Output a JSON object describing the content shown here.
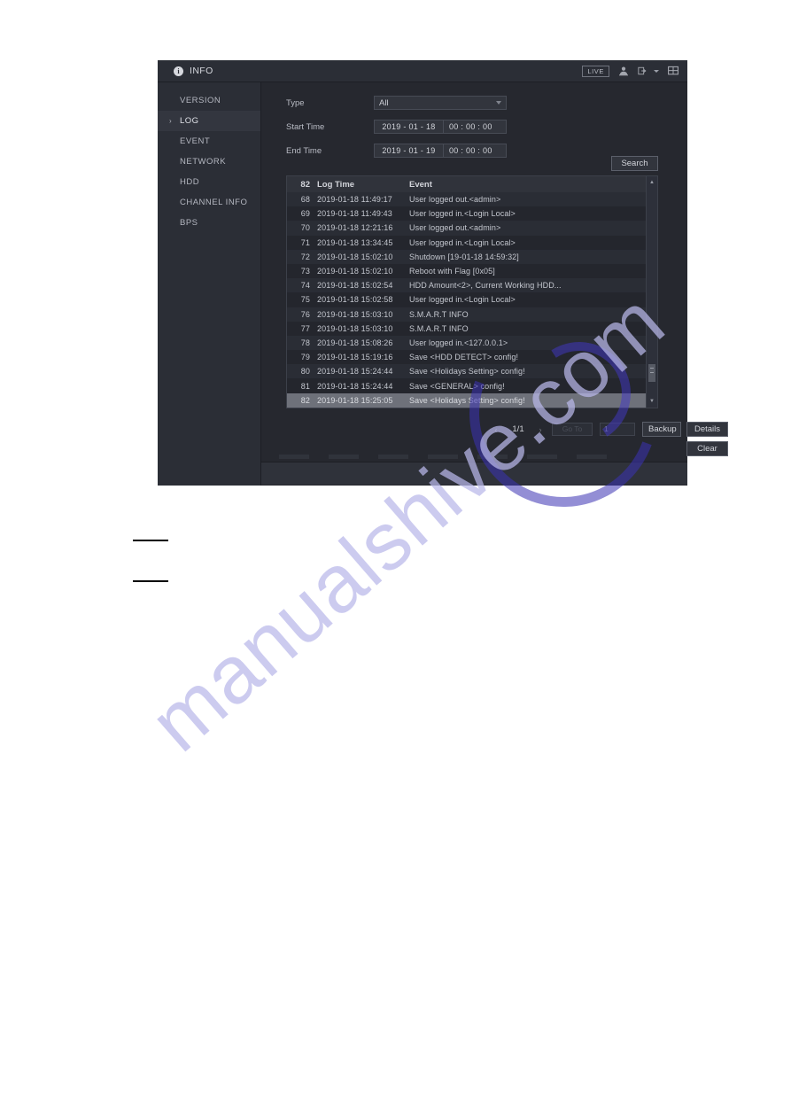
{
  "window": {
    "title": "INFO",
    "title_icon": "info-circle-icon",
    "live_badge": "LIVE",
    "header_icons": [
      "user-icon",
      "logout-icon",
      "screen-split-icon"
    ]
  },
  "sidebar": {
    "items": [
      {
        "label": "VERSION",
        "active": false
      },
      {
        "label": "LOG",
        "active": true
      },
      {
        "label": "EVENT",
        "active": false
      },
      {
        "label": "NETWORK",
        "active": false
      },
      {
        "label": "HDD",
        "active": false
      },
      {
        "label": "CHANNEL INFO",
        "active": false
      },
      {
        "label": "BPS",
        "active": false
      }
    ]
  },
  "form": {
    "type_label": "Type",
    "type_value": "All",
    "start_label": "Start Time",
    "start_date": "2019 - 01 - 18",
    "start_time": "00 : 00 : 00",
    "end_label": "End Time",
    "end_date": "2019 - 01 - 19",
    "end_time": "00 : 00 : 00",
    "search_label": "Search"
  },
  "table": {
    "headers": {
      "index": "82",
      "time": "Log Time",
      "event": "Event"
    },
    "rows": [
      {
        "index": "68",
        "time": "2019-01-18 11:49:17",
        "event": "User logged out.<admin>"
      },
      {
        "index": "69",
        "time": "2019-01-18 11:49:43",
        "event": "User logged in.<Login Local>"
      },
      {
        "index": "70",
        "time": "2019-01-18 12:21:16",
        "event": "User logged out.<admin>"
      },
      {
        "index": "71",
        "time": "2019-01-18 13:34:45",
        "event": "User logged in.<Login Local>"
      },
      {
        "index": "72",
        "time": "2019-01-18 15:02:10",
        "event": "Shutdown [19-01-18 14:59:32]"
      },
      {
        "index": "73",
        "time": "2019-01-18 15:02:10",
        "event": "Reboot with Flag [0x05]"
      },
      {
        "index": "74",
        "time": "2019-01-18 15:02:54",
        "event": "HDD Amount<2>, Current Working HDD..."
      },
      {
        "index": "75",
        "time": "2019-01-18 15:02:58",
        "event": "User logged in.<Login Local>"
      },
      {
        "index": "76",
        "time": "2019-01-18 15:03:10",
        "event": "S.M.A.R.T INFO"
      },
      {
        "index": "77",
        "time": "2019-01-18 15:03:10",
        "event": "S.M.A.R.T INFO"
      },
      {
        "index": "78",
        "time": "2019-01-18 15:08:26",
        "event": "User logged in.<127.0.0.1>"
      },
      {
        "index": "79",
        "time": "2019-01-18 15:19:16",
        "event": "Save <HDD DETECT> config!"
      },
      {
        "index": "80",
        "time": "2019-01-18 15:24:44",
        "event": "Save <Holidays Setting> config!"
      },
      {
        "index": "81",
        "time": "2019-01-18 15:24:44",
        "event": "Save <GENERAL> config!"
      },
      {
        "index": "82",
        "time": "2019-01-18 15:25:05",
        "event": "Save <Holidays Setting> config!",
        "selected": true
      }
    ]
  },
  "pager": {
    "prev": "‹",
    "page": "1/1",
    "next": "›",
    "goto_label": "Go To",
    "goto_value": "1",
    "backup_label": "Backup",
    "details_label": "Details",
    "clear_label": "Clear"
  },
  "watermark": {
    "text": "manualshive.com"
  },
  "colors": {
    "window_bg": "#26282f",
    "panel_bg": "#2b2e36",
    "row_odd": "#2a2d35",
    "row_even": "#24262d",
    "selected_row": "#6e717a",
    "text": "#c8cad2",
    "watermark": "#b9b8ea"
  }
}
